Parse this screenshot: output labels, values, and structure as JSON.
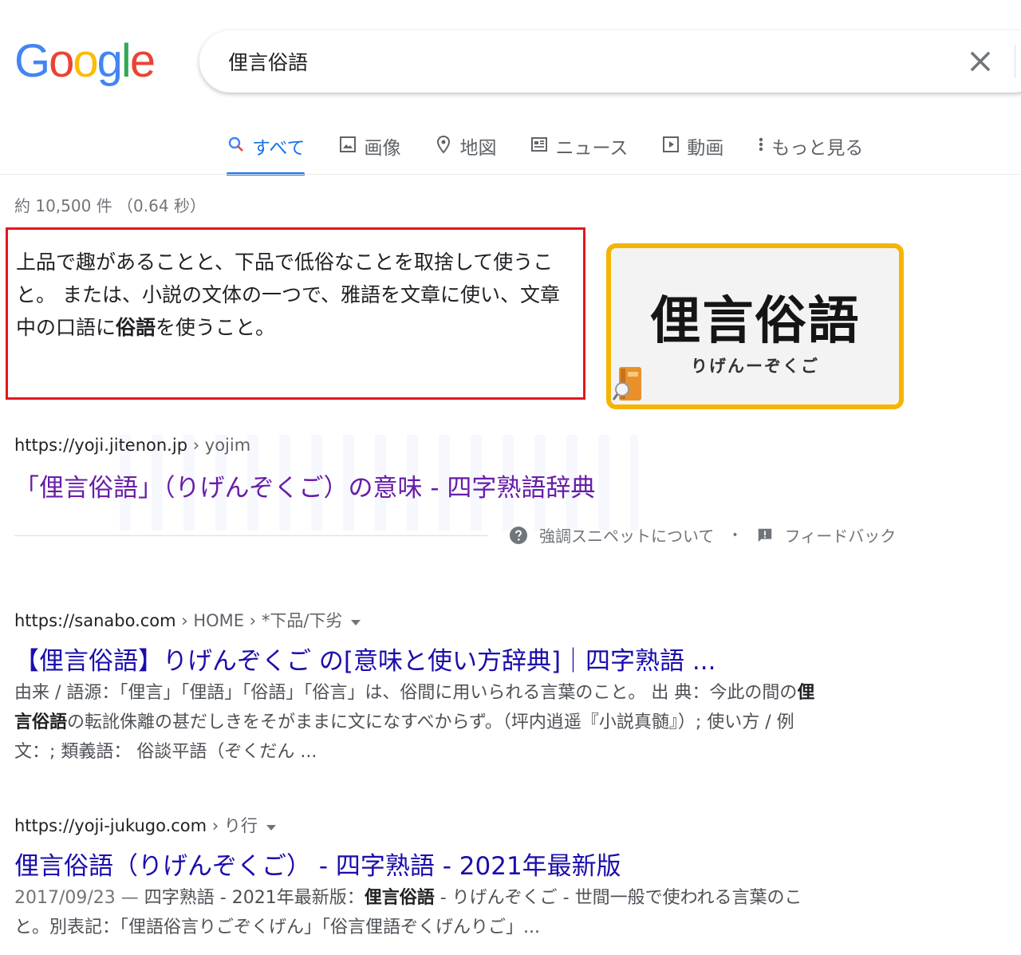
{
  "logo": {
    "letters": [
      "G",
      "o",
      "o",
      "g",
      "l",
      "e"
    ],
    "colors": [
      "#4285F4",
      "#EA4335",
      "#FBBC05",
      "#4285F4",
      "#34A853",
      "#EA4335"
    ]
  },
  "search": {
    "query": "俚言俗語"
  },
  "tabs": [
    {
      "label": "すべて",
      "icon": "search-icon",
      "active": true
    },
    {
      "label": "画像",
      "icon": "image-icon"
    },
    {
      "label": "地図",
      "icon": "map-pin-icon"
    },
    {
      "label": "ニュース",
      "icon": "news-icon"
    },
    {
      "label": "動画",
      "icon": "video-icon"
    },
    {
      "label": "もっと見る",
      "icon": "more-vert-icon"
    }
  ],
  "stats": "約 10,500 件 （0.64 秒）",
  "snippet": {
    "text_before": "上品で趣があることと、下品で低俗なことを取捨して使うこと。 または、小説の文体の一つで、雅語を文章に使い、文章中の口語に",
    "bold": "俗語",
    "text_after": "を使うこと。",
    "image_title": "俚言俗語",
    "image_subtitle": "りげんーぞくご",
    "cite_domain": "https://yoji.jitenon.jp",
    "cite_path": " › yojim",
    "title": "「俚言俗語」（りげんぞくご）の意味 - 四字熟語辞典",
    "about_label": "強調スニペットについて",
    "bullet": "•",
    "feedback_label": "フィードバック"
  },
  "results": [
    {
      "cite_domain": "https://sanabo.com",
      "cite_path": " › HOME › *下品/下劣",
      "title": "【俚言俗語】りげんぞくご の[意味と使い方辞典]｜四字熟語 ...",
      "desc_1": "由来 / 語源：「俚言」「俚語」「俗語」「俗言」は、俗間に用いられる言葉のこと。 出 典：今此の間の",
      "desc_bold": "俚言俗語",
      "desc_2": "の転訛侏離の甚だしきをそがままに文になすべからず。（坪内逍遥『小説真髄』）; 使い方 / 例文：; 類義語： 俗談平語（ぞくだん ..."
    },
    {
      "cite_domain": "https://yoji-jukugo.com",
      "cite_path": " › り行",
      "title": "俚言俗語（りげんぞくご） - 四字熟語 - 2021年最新版",
      "date": "2017/09/23 — ",
      "desc_1": "四字熟語 - 2021年最新版：",
      "desc_bold": "俚言俗語",
      "desc_2": " - りげんぞくご - 世間一般で使われる言葉のこと。別表記：「俚語俗言りごぞくげん」「俗言俚語ぞくげんりご」..."
    }
  ]
}
